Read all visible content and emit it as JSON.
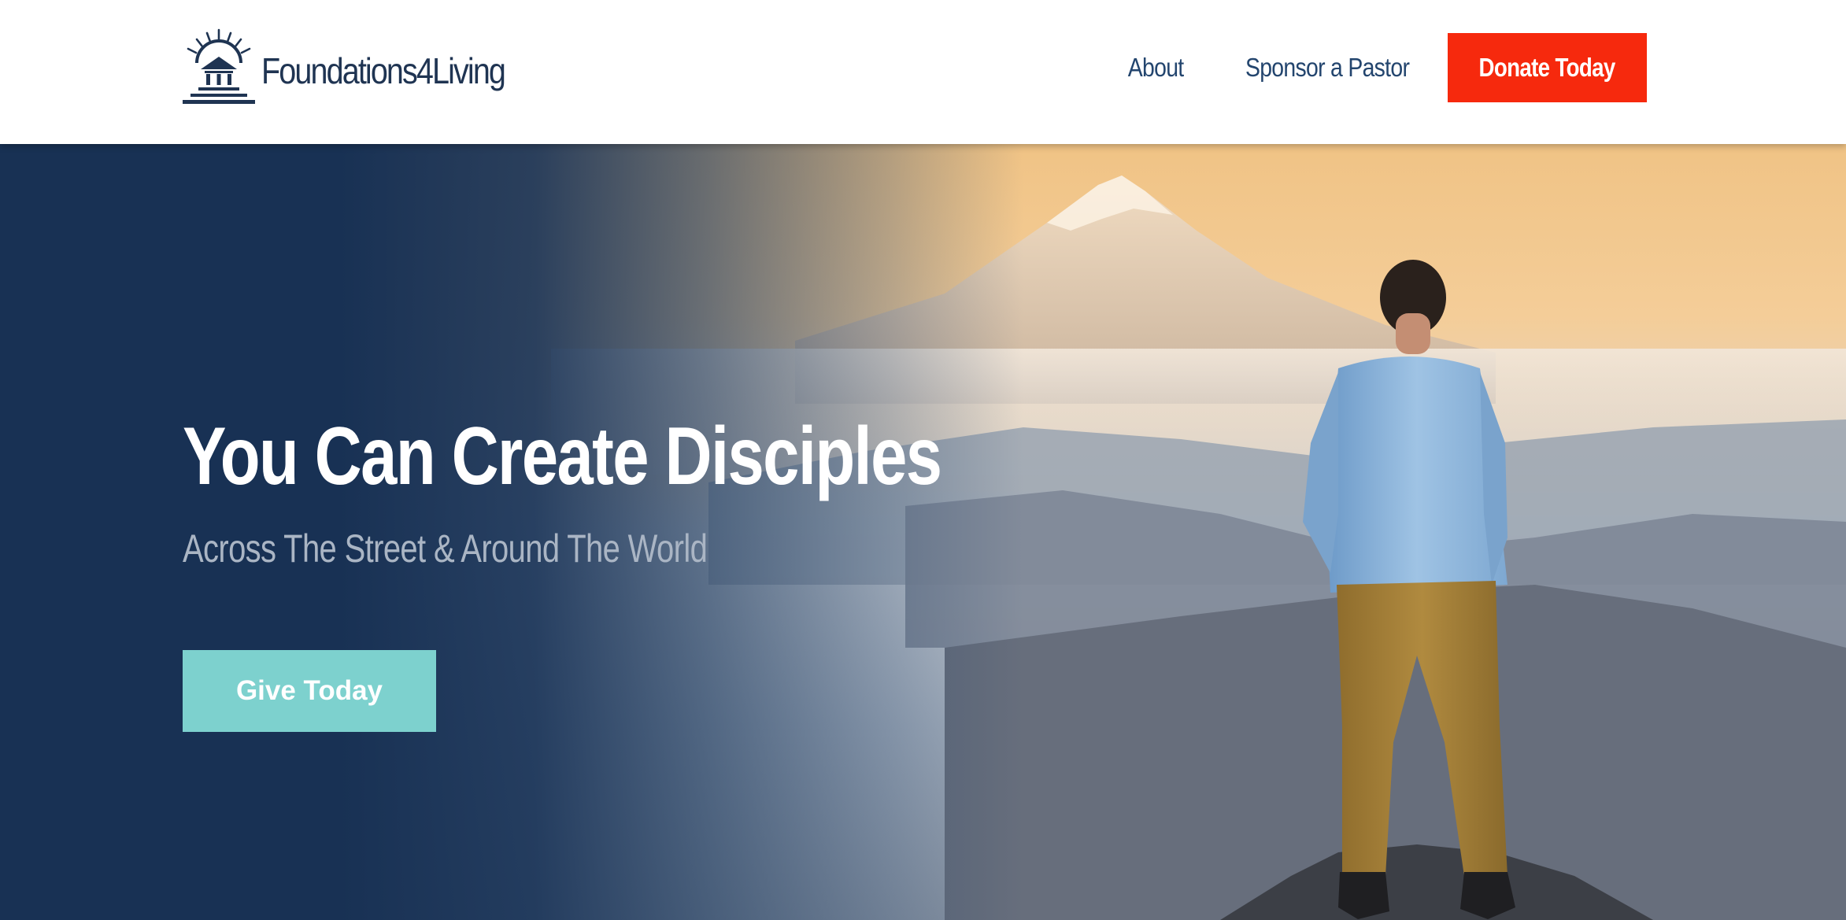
{
  "header": {
    "logo_text": "Foundations4Living",
    "nav": {
      "about_label": "About",
      "sponsor_label": "Sponsor a Pastor"
    },
    "donate_label": "Donate Today"
  },
  "hero": {
    "title": "You Can Create Disciples",
    "subtitle": "Across The Street & Around The World",
    "cta_label": "Give Today"
  },
  "colors": {
    "brand_navy": "#1f3452",
    "nav_text": "#23456e",
    "donate_red": "#f6290d",
    "hero_navy": "#183154",
    "cta_teal": "#7dd1ce",
    "subtitle_gray": "#aab5c4"
  },
  "icons": {
    "logo_mark": "sunrise-house-icon"
  }
}
